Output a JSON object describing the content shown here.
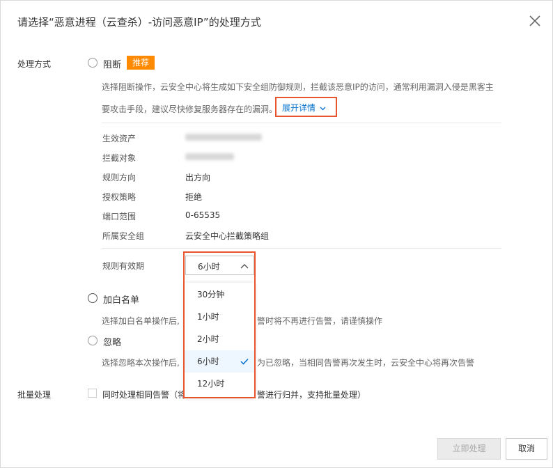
{
  "dialog": {
    "title": "请选择“恶意进程（云查杀）-访问恶意IP”的处理方式",
    "close_icon": "close-icon"
  },
  "method": {
    "label": "处理方式",
    "block": {
      "label": "阻断",
      "badge": "推荐",
      "desc_line1": "选择阻断操作，云安全中心将生成如下安全组防御规则，拦截该恶意IP的访问，通常利用漏洞入侵是黑客主",
      "desc_line2": "要攻击手段，建议尽快修复服务器存在的漏洞。",
      "expand_label": "展开详情",
      "details": [
        {
          "key": "生效资产",
          "value": ""
        },
        {
          "key": "拦截对象",
          "value": ""
        },
        {
          "key": "规则方向",
          "value": "出方向"
        },
        {
          "key": "授权策略",
          "value": "拒绝"
        },
        {
          "key": "端口范围",
          "value": "0-65535"
        },
        {
          "key": "所属安全组",
          "value": "云安全中心拦截策略组"
        }
      ],
      "validity_label": "规则有效期",
      "validity_selected": "6小时",
      "validity_options": [
        "30分钟",
        "1小时",
        "2小时",
        "6小时",
        "12小时"
      ]
    },
    "whitelist": {
      "label": "加白名单",
      "desc_left": "选择加白名单操作后,",
      "desc_right": "警时将不再进行告警，请谨慎操作"
    },
    "ignore": {
      "label": "忽略",
      "desc_left": "选择忽略本次操作后,",
      "desc_right": "为已忽略，当相同告警再次发生时，云安全中心将再次告警"
    }
  },
  "batch": {
    "label": "批量处理",
    "checkbox_left": "同时处理相同告警（将",
    "checkbox_right": "警进行归并，支持批量处理）"
  },
  "footer": {
    "confirm_label": "立即处理",
    "cancel_label": "取消"
  },
  "colors": {
    "accent": "#0070cc",
    "badge": "#ff8a00",
    "highlight_frame": "#e8542e"
  }
}
